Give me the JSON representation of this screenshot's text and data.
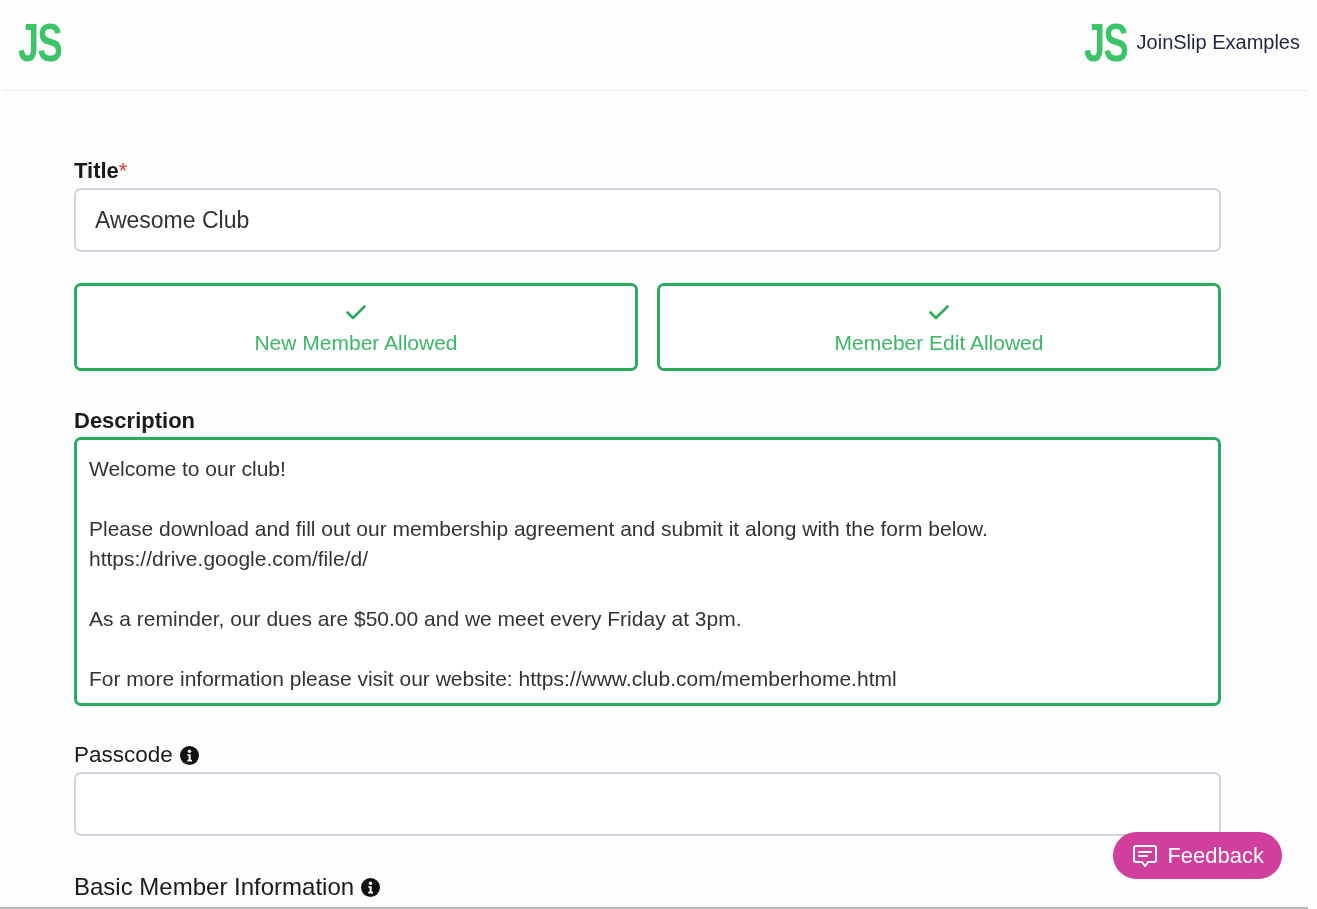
{
  "header": {
    "logo": "JS",
    "brand_logo": "JS",
    "brand_name": "JoinSlip Examples"
  },
  "form": {
    "title": {
      "label": "Title",
      "required_mark": "*",
      "value": "Awesome Club",
      "focused": false
    },
    "toggles": [
      {
        "label": "New Member Allowed",
        "on": true
      },
      {
        "label": "Memeber Edit Allowed",
        "on": true
      }
    ],
    "description": {
      "label": "Description",
      "value": "Welcome to our club!\n\nPlease download and fill out our membership agreement and submit it along with the form below.\nhttps://drive.google.com/file/d/\n\nAs a reminder, our dues are $50.00 and we meet every Friday at 3pm.\n\nFor more information please visit our website: https://www.club.com/memberhome.html",
      "focused": true
    },
    "passcode": {
      "label": "Passcode",
      "info": true,
      "focused": false
    },
    "member_info_section": {
      "label": "Basic Member Information",
      "info": true
    }
  },
  "feedback_button": {
    "label": "Feedback"
  }
}
